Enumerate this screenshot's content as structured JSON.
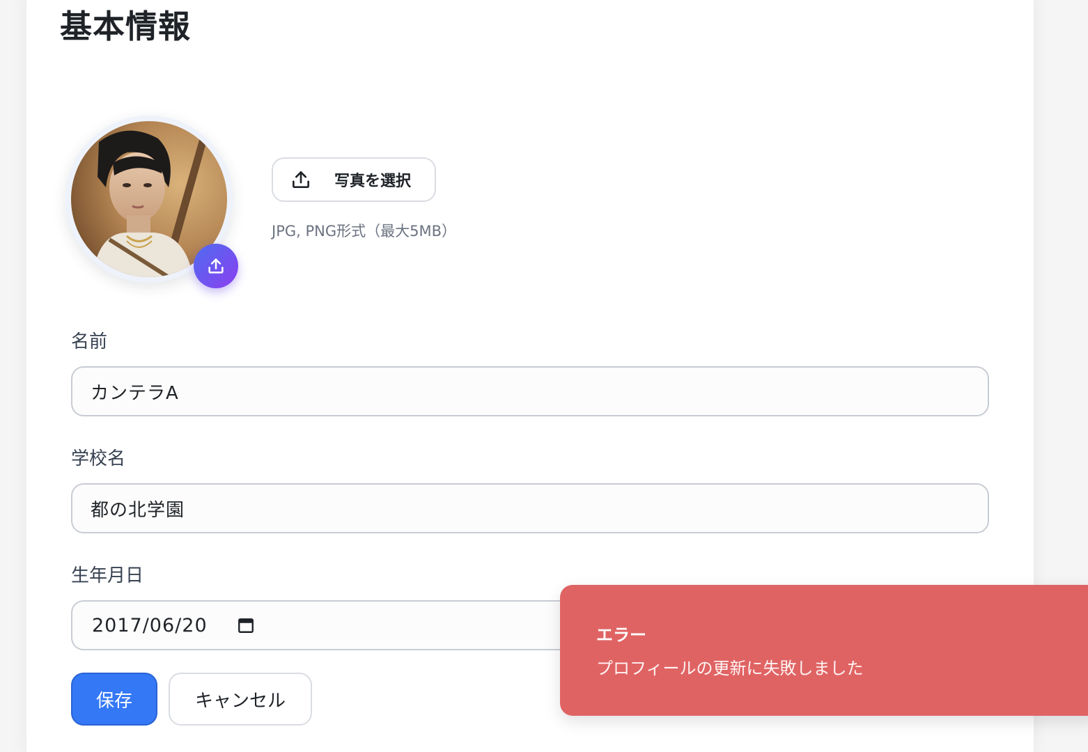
{
  "page": {
    "title": "基本情報"
  },
  "photo": {
    "select_label": "写真を選択",
    "hint": "JPG, PNG形式（最大5MB）",
    "upload_icon": "upload-icon"
  },
  "form": {
    "name": {
      "label": "名前",
      "value": "カンテラA"
    },
    "school": {
      "label": "学校名",
      "value": "都の北学園"
    },
    "birthday": {
      "label": "生年月日",
      "value": "2017/06/20",
      "icon": "calendar-icon"
    }
  },
  "actions": {
    "save_label": "保存",
    "cancel_label": "キャンセル"
  },
  "toast": {
    "title": "エラー",
    "message": "プロフィールの更新に失敗しました",
    "color": "#e06363"
  },
  "colors": {
    "primary": "#3478f6",
    "avatar_badge_from": "#4f6cf0",
    "avatar_badge_to": "#8b3ff0"
  }
}
